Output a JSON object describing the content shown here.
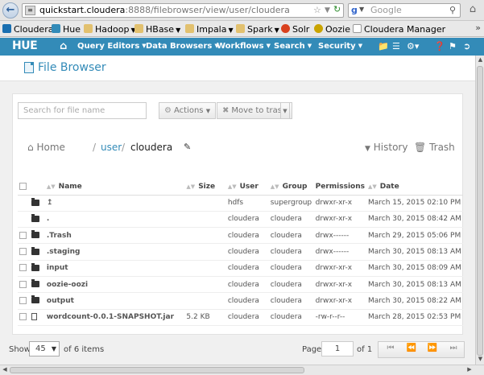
{
  "browser": {
    "url_host": "quickstart.cloudera",
    "url_path": ":8888/filebrowser/view/user/cloudera",
    "search_placeholder": "Google",
    "search_engine_letter": "g"
  },
  "bookmarks": [
    {
      "label": "Cloudera",
      "icon": "cloudera-icon",
      "color": "#1a6fb0",
      "menu": false
    },
    {
      "label": "Hue",
      "icon": "hue-icon",
      "color": "#338bb8",
      "menu": false
    },
    {
      "label": "Hadoop",
      "icon": "folder-icon",
      "color": "#e2c16f",
      "menu": true
    },
    {
      "label": "HBase",
      "icon": "folder-icon",
      "color": "#e2c16f",
      "menu": true
    },
    {
      "label": "Impala",
      "icon": "folder-icon",
      "color": "#e2c16f",
      "menu": true
    },
    {
      "label": "Spark",
      "icon": "folder-icon",
      "color": "#e2c16f",
      "menu": true
    },
    {
      "label": "Solr",
      "icon": "solr-icon",
      "color": "#d9411e",
      "menu": false
    },
    {
      "label": "Oozie",
      "icon": "oozie-icon",
      "color": "#c9a400",
      "menu": false
    },
    {
      "label": "Cloudera Manager",
      "icon": "page-icon",
      "color": "#ffffff",
      "menu": false
    }
  ],
  "hue_nav": {
    "logo": "HUE",
    "items": [
      {
        "label": "Query Editors"
      },
      {
        "label": "Data Browsers"
      },
      {
        "label": "Workflows"
      },
      {
        "label": "Search"
      },
      {
        "label": "Security"
      }
    ]
  },
  "page": {
    "title": "File Browser"
  },
  "toolbar": {
    "filter_placeholder": "Search for file name",
    "actions_label": "Actions",
    "move_to_trash_label": "Move to trash"
  },
  "breadcrumb": {
    "home_label": "Home",
    "separator": "/",
    "user_link": "user",
    "current": "cloudera",
    "history_label": "History",
    "trash_label": "Trash"
  },
  "table": {
    "headers": {
      "name": "Name",
      "size": "Size",
      "user": "User",
      "group": "Group",
      "permissions": "Permissions",
      "date": "Date"
    },
    "rows": [
      {
        "type": "folder",
        "name": "↥",
        "size": "",
        "user": "hdfs",
        "group": "supergroup",
        "permissions": "drwxr-xr-x",
        "date": "March 15, 2015 02:10 PM"
      },
      {
        "type": "folder",
        "name": ".",
        "size": "",
        "user": "cloudera",
        "group": "cloudera",
        "permissions": "drwxr-xr-x",
        "date": "March 30, 2015 08:42 AM"
      },
      {
        "type": "folder",
        "name": ".Trash",
        "size": "",
        "user": "cloudera",
        "group": "cloudera",
        "permissions": "drwx------",
        "date": "March 29, 2015 05:06 PM"
      },
      {
        "type": "folder",
        "name": ".staging",
        "size": "",
        "user": "cloudera",
        "group": "cloudera",
        "permissions": "drwx------",
        "date": "March 30, 2015 08:13 AM"
      },
      {
        "type": "folder",
        "name": "input",
        "size": "",
        "user": "cloudera",
        "group": "cloudera",
        "permissions": "drwxr-xr-x",
        "date": "March 30, 2015 08:09 AM"
      },
      {
        "type": "folder",
        "name": "oozie-oozi",
        "size": "",
        "user": "cloudera",
        "group": "cloudera",
        "permissions": "drwxr-xr-x",
        "date": "March 30, 2015 08:13 AM"
      },
      {
        "type": "folder",
        "name": "output",
        "size": "",
        "user": "cloudera",
        "group": "cloudera",
        "permissions": "drwxr-xr-x",
        "date": "March 30, 2015 08:22 AM"
      },
      {
        "type": "file",
        "name": "wordcount-0.0.1-SNAPSHOT.jar",
        "size": "5.2 KB",
        "user": "cloudera",
        "group": "cloudera",
        "permissions": "-rw-r--r--",
        "date": "March 28, 2015 02:53 PM"
      }
    ]
  },
  "pager": {
    "show_label": "Show",
    "page_size": "45",
    "of_items": "of 6 items",
    "page_label": "Page",
    "page_value": "1",
    "of_pages": "of 1"
  },
  "colors": {
    "hue_blue": "#338bb8"
  }
}
